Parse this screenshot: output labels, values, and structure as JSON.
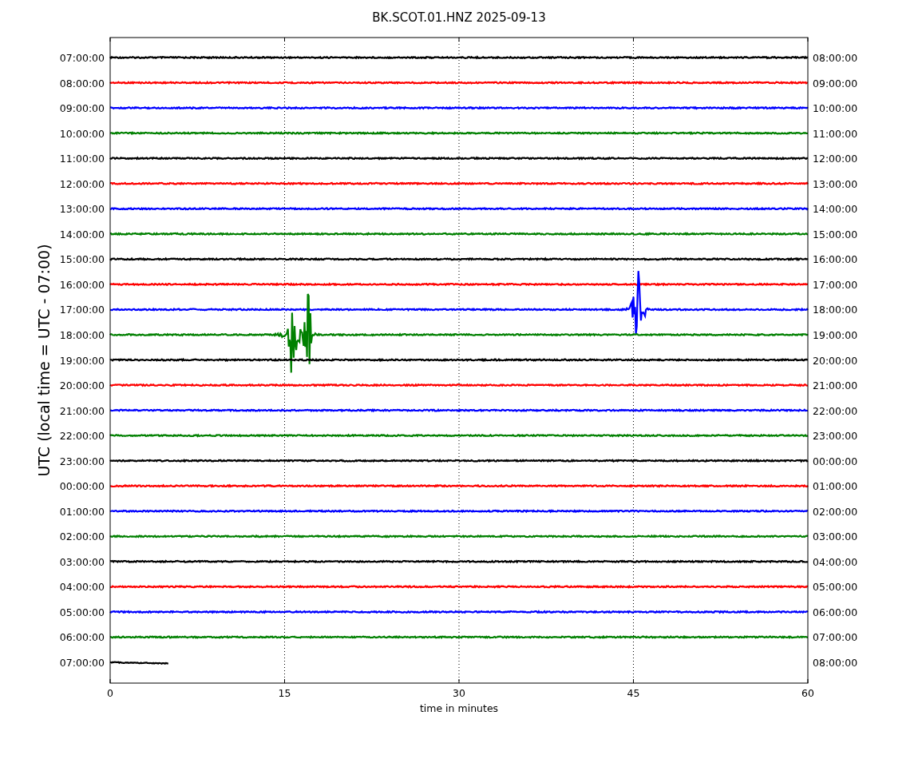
{
  "title": "BK.SCOT.01.HNZ 2025-09-13",
  "ylabel": "UTC (local time = UTC - 07:00)",
  "xlabel": "time in minutes",
  "xticks": [
    "0",
    "15",
    "30",
    "45",
    "60"
  ],
  "rows": [
    {
      "left": "07:00:00",
      "right": "08:00:00",
      "color": "#000000",
      "kind": "full"
    },
    {
      "left": "08:00:00",
      "right": "09:00:00",
      "color": "#ff0000",
      "kind": "full"
    },
    {
      "left": "09:00:00",
      "right": "10:00:00",
      "color": "#0000ff",
      "kind": "full"
    },
    {
      "left": "10:00:00",
      "right": "11:00:00",
      "color": "#008000",
      "kind": "full"
    },
    {
      "left": "11:00:00",
      "right": "12:00:00",
      "color": "#000000",
      "kind": "full"
    },
    {
      "left": "12:00:00",
      "right": "13:00:00",
      "color": "#ff0000",
      "kind": "full"
    },
    {
      "left": "13:00:00",
      "right": "14:00:00",
      "color": "#0000ff",
      "kind": "full"
    },
    {
      "left": "14:00:00",
      "right": "15:00:00",
      "color": "#008000",
      "kind": "full"
    },
    {
      "left": "15:00:00",
      "right": "16:00:00",
      "color": "#000000",
      "kind": "full"
    },
    {
      "left": "16:00:00",
      "right": "17:00:00",
      "color": "#ff0000",
      "kind": "full"
    },
    {
      "left": "17:00:00",
      "right": "18:00:00",
      "color": "#0000ff",
      "kind": "event"
    },
    {
      "left": "18:00:00",
      "right": "19:00:00",
      "color": "#008000",
      "kind": "event"
    },
    {
      "left": "19:00:00",
      "right": "20:00:00",
      "color": "#000000",
      "kind": "full"
    },
    {
      "left": "20:00:00",
      "right": "21:00:00",
      "color": "#ff0000",
      "kind": "full"
    },
    {
      "left": "21:00:00",
      "right": "22:00:00",
      "color": "#0000ff",
      "kind": "full"
    },
    {
      "left": "22:00:00",
      "right": "23:00:00",
      "color": "#008000",
      "kind": "full"
    },
    {
      "left": "23:00:00",
      "right": "00:00:00",
      "color": "#000000",
      "kind": "full"
    },
    {
      "left": "00:00:00",
      "right": "01:00:00",
      "color": "#ff0000",
      "kind": "full"
    },
    {
      "left": "01:00:00",
      "right": "02:00:00",
      "color": "#0000ff",
      "kind": "full"
    },
    {
      "left": "02:00:00",
      "right": "03:00:00",
      "color": "#008000",
      "kind": "full"
    },
    {
      "left": "03:00:00",
      "right": "04:00:00",
      "color": "#000000",
      "kind": "full"
    },
    {
      "left": "04:00:00",
      "right": "05:00:00",
      "color": "#ff0000",
      "kind": "full"
    },
    {
      "left": "05:00:00",
      "right": "06:00:00",
      "color": "#0000ff",
      "kind": "full"
    },
    {
      "left": "06:00:00",
      "right": "07:00:00",
      "color": "#008000",
      "kind": "full"
    },
    {
      "left": "07:00:00",
      "right": "08:00:00",
      "color": "#000000",
      "kind": "partial"
    }
  ]
}
